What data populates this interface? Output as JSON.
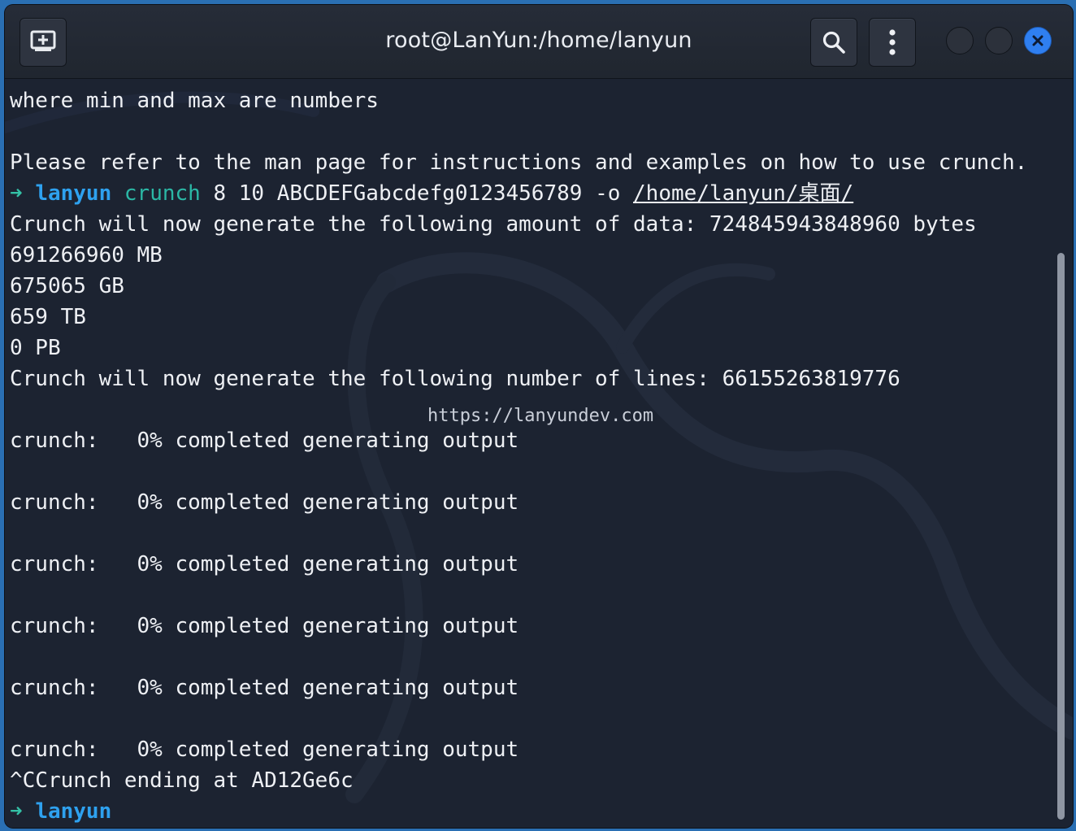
{
  "window": {
    "title": "root@LanYun:/home/lanyun"
  },
  "toolbar": {
    "new_tab_icon": "new-tab-icon",
    "search_icon": "search-icon",
    "menu_icon": "kebab-menu-icon",
    "close_icon": "close-icon"
  },
  "terminal": {
    "lines": [
      {
        "text": "where min and max are numbers"
      },
      {
        "text": ""
      },
      {
        "text": "Please refer to the man page for instructions and examples on how to use crunch."
      },
      {
        "prompt_arrow": "➜",
        "prompt_user": "lanyun",
        "command": "crunch",
        "args": "8 10 ABCDEFGabcdefg0123456789 -o",
        "path": "/home/lanyun/桌面/"
      },
      {
        "text": "Crunch will now generate the following amount of data: 724845943848960 bytes"
      },
      {
        "text": "691266960 MB"
      },
      {
        "text": "675065 GB"
      },
      {
        "text": "659 TB"
      },
      {
        "text": "0 PB"
      },
      {
        "text": "Crunch will now generate the following number of lines: 66155263819776"
      },
      {
        "text": "crunch:   0% completed generating output"
      },
      {
        "text": "crunch:   0% completed generating output"
      },
      {
        "text": "crunch:   0% completed generating output"
      },
      {
        "text": "crunch:   0% completed generating output"
      },
      {
        "text": "crunch:   0% completed generating output"
      },
      {
        "text": "crunch:   0% completed generating output"
      },
      {
        "text": "^CCrunch ending at AD12Ge6c"
      },
      {
        "prompt_arrow": "➜",
        "prompt_user": "lanyun"
      }
    ],
    "overlay_url": "https://lanyundev.com"
  },
  "colors": {
    "background": "#1c2331",
    "prompt_arrow": "#34c1a6",
    "prompt_user": "#2ea1ef",
    "command": "#2bb7a5",
    "close_button": "#2f7ff0"
  }
}
